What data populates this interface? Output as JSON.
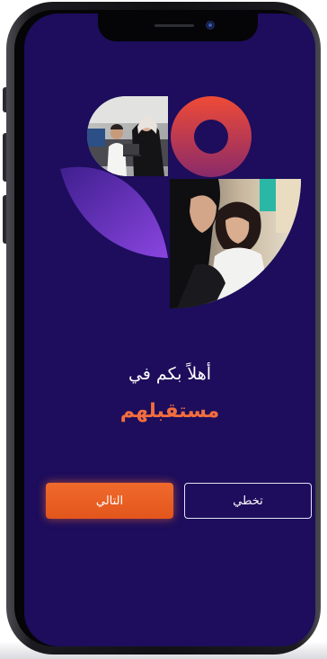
{
  "welcome": {
    "title": "أهلاً بكم في",
    "brand": "مستقبلهم"
  },
  "buttons": {
    "skip_label": "تخطي",
    "next_label": "التالي"
  },
  "colors": {
    "screen_background": "#1d0d5c",
    "accent_orange": "#f26d3d",
    "button_orange": "#e8601f",
    "ring_red": "#e0433f",
    "leaf_purple": "#6b36c9"
  }
}
